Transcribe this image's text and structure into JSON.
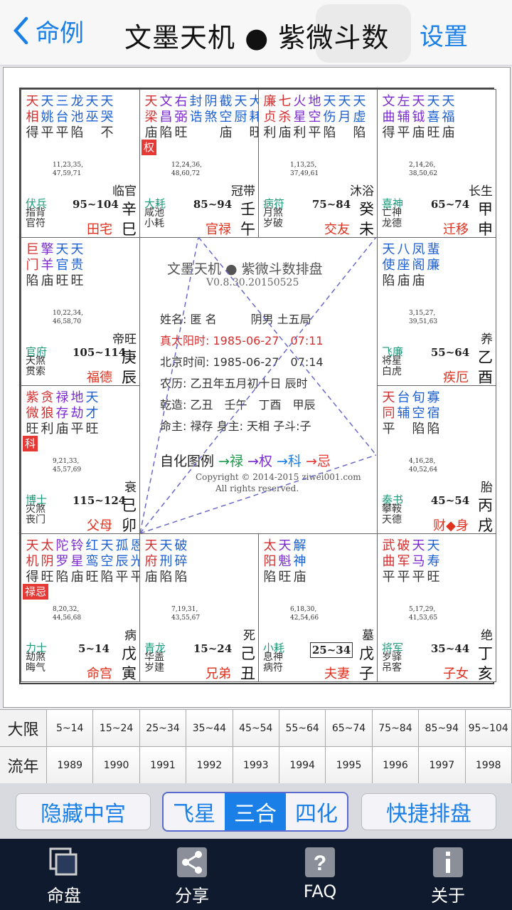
{
  "nav": {
    "back": "命例",
    "title": "文墨天机 ● 紫微斗数",
    "settings": "设置"
  },
  "colors": {
    "red": "#e53935",
    "blue": "#1a7fe6",
    "green": "#1a9a7a",
    "purple": "#7a2ad0"
  },
  "cells": [
    {
      "stars": [
        [
          "天",
          "相",
          "得",
          "#d32f2f"
        ],
        [
          "天",
          "姚",
          "平",
          "#1c5fd0"
        ],
        [
          "三",
          "台",
          "平",
          "#1c5fd0"
        ],
        [
          "龙",
          "池",
          "陷",
          "#1c5fd0"
        ],
        [
          "天",
          "巫",
          "",
          "#1c5fd0"
        ],
        [
          "天",
          "哭",
          "不",
          "#1c5fd0"
        ]
      ],
      "hua": "",
      "nums": [
        "11,23,35,",
        "47,59,71"
      ],
      "chang": "临官",
      "boshi": "伏兵",
      "small": [
        "指背",
        "官符"
      ],
      "range": "95~104",
      "box": false,
      "palace": "田宅",
      "gan": "辛",
      "zhi": "巳"
    },
    {
      "stars": [
        [
          "天",
          "梁",
          "庙",
          "#d32f2f"
        ],
        [
          "文",
          "昌",
          "陷",
          "#7a2ad0"
        ],
        [
          "右",
          "弼",
          "旺",
          "#7a2ad0"
        ],
        [
          "封",
          "诰",
          "",
          "#1c5fd0"
        ],
        [
          "阴",
          "煞",
          "",
          "#1c5fd0"
        ],
        [
          "截",
          "空",
          "庙",
          "#1c5fd0"
        ],
        [
          "天",
          "厨",
          "",
          "#1c5fd0"
        ],
        [
          "大",
          "耗",
          "旺",
          "#1c5fd0"
        ]
      ],
      "hua": "权",
      "nums": [
        "12,24,36,",
        "48,60,72"
      ],
      "chang": "冠带",
      "boshi": "大耗",
      "small": [
        "咸池",
        "小耗"
      ],
      "range": "85~94",
      "box": false,
      "palace": "官禄",
      "gan": "壬",
      "zhi": "午"
    },
    {
      "stars": [
        [
          "廉",
          "贞",
          "利",
          "#d32f2f"
        ],
        [
          "七",
          "杀",
          "庙",
          "#d32f2f"
        ],
        [
          "火",
          "星",
          "利",
          "#7a2ad0"
        ],
        [
          "地",
          "空",
          "平",
          "#7a2ad0"
        ],
        [
          "天",
          "伤",
          "陷",
          "#1c5fd0"
        ],
        [
          "天",
          "月",
          "",
          "#1c5fd0"
        ],
        [
          "天",
          "虚",
          "陷",
          "#1c5fd0"
        ]
      ],
      "hua": "",
      "nums": [
        "1,13,25,",
        "37,49,61"
      ],
      "chang": "沐浴",
      "boshi": "病符",
      "small": [
        "月煞",
        "岁破"
      ],
      "range": "75~84",
      "box": false,
      "palace": "交友",
      "gan": "癸",
      "zhi": "未"
    },
    {
      "stars": [
        [
          "文",
          "曲",
          "得",
          "#7a2ad0"
        ],
        [
          "左",
          "辅",
          "平",
          "#7a2ad0"
        ],
        [
          "天",
          "钺",
          "庙",
          "#7a2ad0"
        ],
        [
          "天",
          "喜",
          "旺",
          "#1c5fd0"
        ],
        [
          "天",
          "福",
          "庙",
          "#1c5fd0"
        ]
      ],
      "hua": "",
      "nums": [
        "2,14,26,",
        "38,50,62"
      ],
      "chang": "长生",
      "boshi": "喜神",
      "small": [
        "亡神",
        "龙德"
      ],
      "range": "65~74",
      "box": false,
      "palace": "迁移",
      "gan": "甲",
      "zhi": "申"
    },
    {
      "stars": [
        [
          "巨",
          "门",
          "陷",
          "#d32f2f"
        ],
        [
          "擎",
          "羊",
          "庙",
          "#7a2ad0"
        ],
        [
          "天",
          "官",
          "旺",
          "#1c5fd0"
        ],
        [
          "天",
          "贵",
          "旺",
          "#1c5fd0"
        ]
      ],
      "hua": "",
      "nums": [
        "10,22,34,",
        "46,58,70"
      ],
      "chang": "帝旺",
      "boshi": "官府",
      "small": [
        "天煞",
        "贯索"
      ],
      "range": "105~114",
      "box": false,
      "palace": "福德",
      "gan": "庚",
      "zhi": "辰"
    },
    {
      "stars": [
        [
          "天",
          "使",
          "陷",
          "#1c5fd0"
        ],
        [
          "八",
          "座",
          "庙",
          "#1c5fd0"
        ],
        [
          "凤",
          "阁",
          "庙",
          "#1c5fd0"
        ],
        [
          "蜚",
          "廉",
          "",
          "#1c5fd0"
        ]
      ],
      "hua": "",
      "nums": [
        "3,15,27,",
        "39,51,63"
      ],
      "chang": "养",
      "boshi": "飞廉",
      "small": [
        "将星",
        "白虎"
      ],
      "range": "55~64",
      "box": false,
      "palace": "疾厄",
      "gan": "乙",
      "zhi": "酉"
    },
    {
      "stars": [
        [
          "紫",
          "微",
          "旺",
          "#d32f2f"
        ],
        [
          "贪",
          "狼",
          "利",
          "#d32f2f"
        ],
        [
          "禄",
          "存",
          "庙",
          "#7a2ad0"
        ],
        [
          "地",
          "劫",
          "平",
          "#7a2ad0"
        ],
        [
          "天",
          "才",
          "旺",
          "#1c5fd0"
        ]
      ],
      "hua": "科",
      "nums": [
        "9,21,33,",
        "45,57,69"
      ],
      "chang": "衰",
      "boshi": "博士",
      "small": [
        "灾煞",
        "丧门"
      ],
      "range": "115~124",
      "box": false,
      "palace": "父母",
      "gan": "己",
      "zhi": "卯"
    },
    {
      "stars": [
        [
          "天",
          "同",
          "平",
          "#d32f2f"
        ],
        [
          "台",
          "辅",
          "",
          "#1c5fd0"
        ],
        [
          "旬",
          "空",
          "陷",
          "#1c5fd0"
        ],
        [
          "寡",
          "宿",
          "陷",
          "#1c5fd0"
        ]
      ],
      "hua": "",
      "nums": [
        "4,16,28,",
        "40,52,64"
      ],
      "chang": "胎",
      "boshi": "奏书",
      "small": [
        "攀鞍",
        "天德"
      ],
      "range": "45~54",
      "box": false,
      "palace": "财◆身",
      "gan": "丙",
      "zhi": "戌"
    },
    {
      "stars": [
        [
          "天",
          "机",
          "得",
          "#d32f2f"
        ],
        [
          "太",
          "阴",
          "旺",
          "#d32f2f"
        ],
        [
          "陀",
          "罗",
          "陷",
          "#7a2ad0"
        ],
        [
          "铃",
          "星",
          "庙",
          "#7a2ad0"
        ],
        [
          "红",
          "鸾",
          "旺",
          "#1c5fd0"
        ],
        [
          "天",
          "空",
          "陷",
          "#1c5fd0"
        ],
        [
          "孤",
          "辰",
          "平",
          "#1c5fd0"
        ],
        [
          "恩",
          "光",
          "平",
          "#1c5fd0"
        ]
      ],
      "hua": "禄忌",
      "nums": [
        "8,20,32,",
        "44,56,68"
      ],
      "chang": "病",
      "boshi": "力士",
      "small": [
        "劫煞",
        "晦气"
      ],
      "range": "5~14",
      "box": false,
      "palace": "命宫",
      "gan": "戊",
      "zhi": "寅"
    },
    {
      "stars": [
        [
          "天",
          "府",
          "庙",
          "#d32f2f"
        ],
        [
          "天",
          "刑",
          "陷",
          "#1c5fd0"
        ],
        [
          "破",
          "碎",
          "陷",
          "#1c5fd0"
        ]
      ],
      "hua": "",
      "nums": [
        "7,19,31,",
        "43,55,67"
      ],
      "chang": "死",
      "boshi": "青龙",
      "small": [
        "华盖",
        "岁建"
      ],
      "range": "15~24",
      "box": false,
      "palace": "兄弟",
      "gan": "己",
      "zhi": "丑"
    },
    {
      "stars": [
        [
          "太",
          "阳",
          "陷",
          "#d32f2f"
        ],
        [
          "天",
          "魁",
          "旺",
          "#7a2ad0"
        ],
        [
          "解",
          "神",
          "庙",
          "#1c5fd0"
        ]
      ],
      "hua": "",
      "nums": [
        "6,18,30,",
        "42,54,66"
      ],
      "chang": "墓",
      "boshi": "小耗",
      "small": [
        "息神",
        "病符"
      ],
      "range": "25~34",
      "box": true,
      "palace": "夫妻",
      "gan": "戊",
      "zhi": "子"
    },
    {
      "stars": [
        [
          "武",
          "曲",
          "平",
          "#d32f2f"
        ],
        [
          "破",
          "军",
          "平",
          "#d32f2f"
        ],
        [
          "天",
          "马",
          "平",
          "#7a2ad0"
        ],
        [
          "天",
          "寿",
          "旺",
          "#1c5fd0"
        ]
      ],
      "hua": "",
      "nums": [
        "5,17,29,",
        "41,53,65"
      ],
      "chang": "绝",
      "boshi": "将军",
      "small": [
        "岁驿",
        "吊客"
      ],
      "range": "35~44",
      "box": false,
      "palace": "子女",
      "gan": "丁",
      "zhi": "亥"
    }
  ],
  "center": {
    "title": "文墨天机 ● 紫微斗数排盘",
    "version": "V0.8.30.20150525",
    "lines": [
      "姓名: 匿 名　　　阴男 土五局",
      "真太阳时: 1985-06-27　07:11",
      "北京时间: 1985-06-27　07:14",
      "农历: 乙丑年五月初十日 辰时",
      "乾造: 乙丑　壬午　丁酉　甲辰",
      "命主: 禄存 身主: 天相 子斗:子"
    ],
    "self_label": "自化图例",
    "self_lu": "→禄",
    "self_quan": "→权",
    "self_ke": "→科",
    "self_ji": "→忌",
    "copyright": "Copyright © 2014-2015 ziwei001.com",
    "rights": "All rights reserved."
  },
  "table": {
    "daxian_label": "大限",
    "liunian_label": "流年",
    "daxian": [
      "5~14",
      "15~24",
      "25~34",
      "35~44",
      "45~54",
      "55~64",
      "65~74",
      "75~84",
      "85~94",
      "95~104"
    ],
    "liunian": [
      "1989",
      "1990",
      "1991",
      "1992",
      "1993",
      "1994",
      "1995",
      "1996",
      "1997",
      "1998"
    ]
  },
  "controls": {
    "hide": "隐藏中宫",
    "seg": [
      "飞星",
      "三合",
      "四化"
    ],
    "quick": "快捷排盘"
  },
  "tabs": [
    {
      "label": "命盘",
      "icon": "chart-icon"
    },
    {
      "label": "分享",
      "icon": "share-icon"
    },
    {
      "label": "FAQ",
      "icon": "help-icon"
    },
    {
      "label": "关于",
      "icon": "info-icon"
    }
  ]
}
